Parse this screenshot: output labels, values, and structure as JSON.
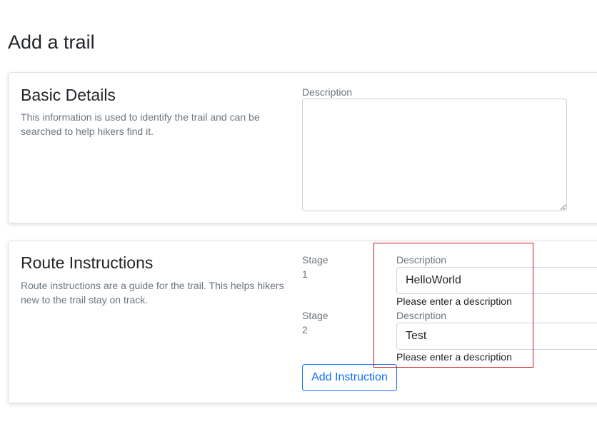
{
  "page": {
    "title": "Add a trail"
  },
  "basic_details": {
    "heading": "Basic Details",
    "description": "This information is used to identify the trail and can be searched to help hikers find it.",
    "field_label": "Description",
    "field_value": ""
  },
  "route_instructions": {
    "heading": "Route Instructions",
    "description": "Route instructions are a guide for the trail. This helps hikers new to the trail stay on track.",
    "stages": [
      {
        "stage_label": "Stage",
        "stage_number": "1",
        "description_label": "Description",
        "description_value": "HelloWorld",
        "validation_message": "Please enter a description"
      },
      {
        "stage_label": "Stage",
        "stage_number": "2",
        "description_label": "Description",
        "description_value": "Test",
        "validation_message": "Please enter a description"
      }
    ],
    "add_button_label": "Add Instruction"
  },
  "colors": {
    "primary": "#0d6efd",
    "muted_text": "#6c757d",
    "highlight": "#d0121b"
  }
}
